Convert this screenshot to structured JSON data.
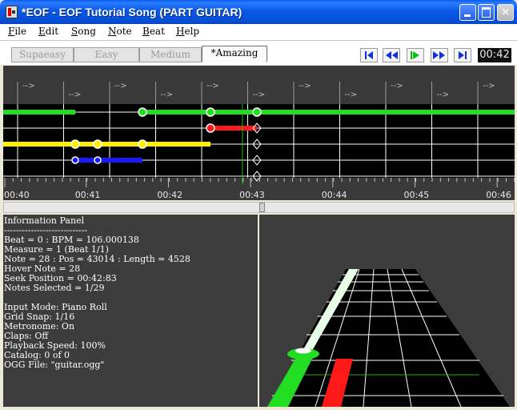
{
  "window": {
    "title": "*EOF - EOF Tutorial Song (PART GUITAR)",
    "min_label": "",
    "max_label": "",
    "close_label": "✕"
  },
  "menu": [
    "File",
    "Edit",
    "Song",
    "Note",
    "Beat",
    "Help"
  ],
  "difficulty_tabs": [
    {
      "label": "Supaeasy",
      "active": false
    },
    {
      "label": "Easy",
      "active": false
    },
    {
      "label": "Medium",
      "active": false
    },
    {
      "label": "*Amazing",
      "active": true
    }
  ],
  "transport": {
    "buttons": [
      "skip-to-start",
      "rewind",
      "play",
      "fast-forward",
      "skip-to-end"
    ],
    "time": "00:42"
  },
  "editor": {
    "time_labels": [
      "00:40",
      "00:41",
      "00:42",
      "00:43",
      "00:44",
      "00:45",
      "00:46"
    ],
    "beat_markers": [
      "-->",
      "-->",
      "-->",
      "-->",
      "-->",
      "-->",
      "-->",
      "-->",
      "-->",
      "-->",
      "-->"
    ],
    "lane_colors": [
      "#22dd22",
      "#ff1a1a",
      "#ffee00",
      "#1a1aff",
      "#ff8800"
    ]
  },
  "info_panel": {
    "title": "Information Panel",
    "divider": "----------------------------",
    "lines": [
      "Beat = 0 : BPM = 106.000138",
      "Measure = 1 (Beat 1/1)",
      "Note = 28 : Pos = 43014 : Length = 4528",
      "Hover Note = 28",
      "Seek Position = 00:42:83",
      "Notes Selected = 1/29",
      "",
      "Input Mode: Piano Roll",
      "Grid Snap: 1/16",
      "Metronome: On",
      "Claps: Off",
      "Playback Speed: 100%",
      "Catalog: 0 of 0",
      "OGG File: \"guitar.ogg\""
    ]
  }
}
